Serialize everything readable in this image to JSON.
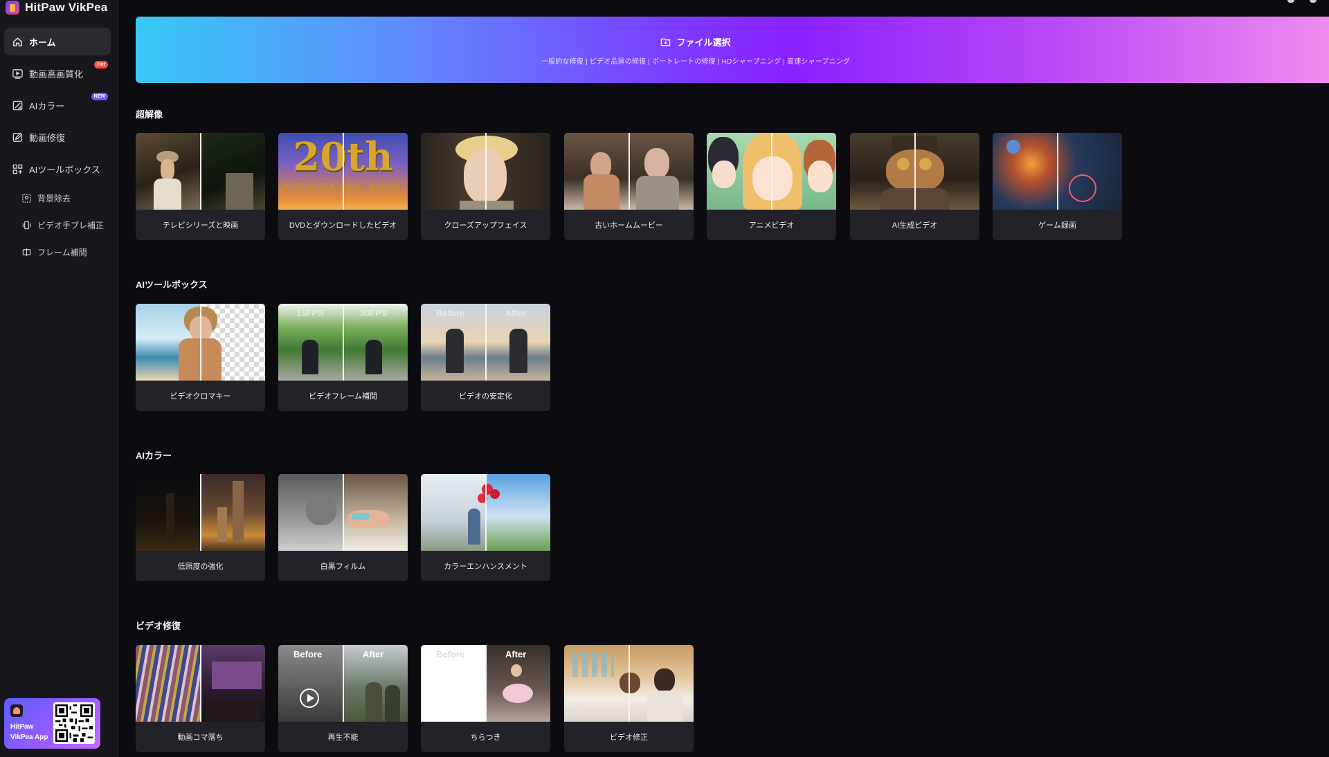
{
  "app": {
    "title": "HitPaw VikPea"
  },
  "sidebar": {
    "items": [
      {
        "label": "ホーム",
        "icon": "home-icon",
        "active": true
      },
      {
        "label": "動画高画質化",
        "icon": "video-enhance-icon",
        "badge": "Hot"
      },
      {
        "label": "AIカラー",
        "icon": "ai-color-icon",
        "badge": "NEW"
      },
      {
        "label": "動画修復",
        "icon": "video-repair-icon"
      },
      {
        "label": "AIツールボックス",
        "icon": "ai-toolbox-icon"
      }
    ],
    "subitems": [
      {
        "label": "背景除去",
        "icon": "background-remove-icon"
      },
      {
        "label": "ビデオ手ブレ補正",
        "icon": "stabilize-icon"
      },
      {
        "label": "フレーム補間",
        "icon": "frame-interpolation-icon"
      }
    ],
    "promo": {
      "line1": "HitPaw",
      "line2": "VikPea App"
    }
  },
  "banner": {
    "title": "ファイル選択",
    "subtitle": "一般的な修復 | ビデオ品質の修復 | ポートレートの修復 | HDシャープニング | 高速シャープニング"
  },
  "sections": {
    "super_resolution": {
      "title": "超解像",
      "cards": [
        {
          "label": "テレビシリーズと映画"
        },
        {
          "label": "DVDとダウンロードしたビデオ",
          "thumb_text": "20th",
          "thumb_text2": "CENTURY FOX"
        },
        {
          "label": "クローズアップフェイス"
        },
        {
          "label": "古いホームムービー"
        },
        {
          "label": "アニメビデオ"
        },
        {
          "label": "AI生成ビデオ"
        },
        {
          "label": "ゲーム録画"
        }
      ]
    },
    "ai_toolbox": {
      "title": "AIツールボックス",
      "cards": [
        {
          "label": "ビデオクロマキー"
        },
        {
          "label": "ビデオフレーム補間",
          "tag_left": "15FPS",
          "tag_right": "30FPS"
        },
        {
          "label": "ビデオの安定化",
          "tag_left": "Before",
          "tag_right": "After"
        }
      ]
    },
    "ai_color": {
      "title": "AIカラー",
      "cards": [
        {
          "label": "低照度の強化"
        },
        {
          "label": "白黒フィルム"
        },
        {
          "label": "カラーエンハンスメント"
        }
      ]
    },
    "video_repair": {
      "title": "ビデオ修復",
      "cards": [
        {
          "label": "動画コマ落ち"
        },
        {
          "label": "再生不能",
          "tag_left": "Before",
          "tag_right": "After"
        },
        {
          "label": "ちらつき",
          "tag_left": "Before",
          "tag_right": "After"
        },
        {
          "label": "ビデオ修正"
        }
      ]
    }
  },
  "colors": {
    "background": "#0c0c10",
    "sidebar": "#17171c",
    "card": "#222228",
    "banner_start": "#38c9f5",
    "banner_mid": "#8a20ff",
    "banner_end": "#f08bf0",
    "badge_hot": "#ff4b3e",
    "badge_new": "#7b55ff"
  }
}
